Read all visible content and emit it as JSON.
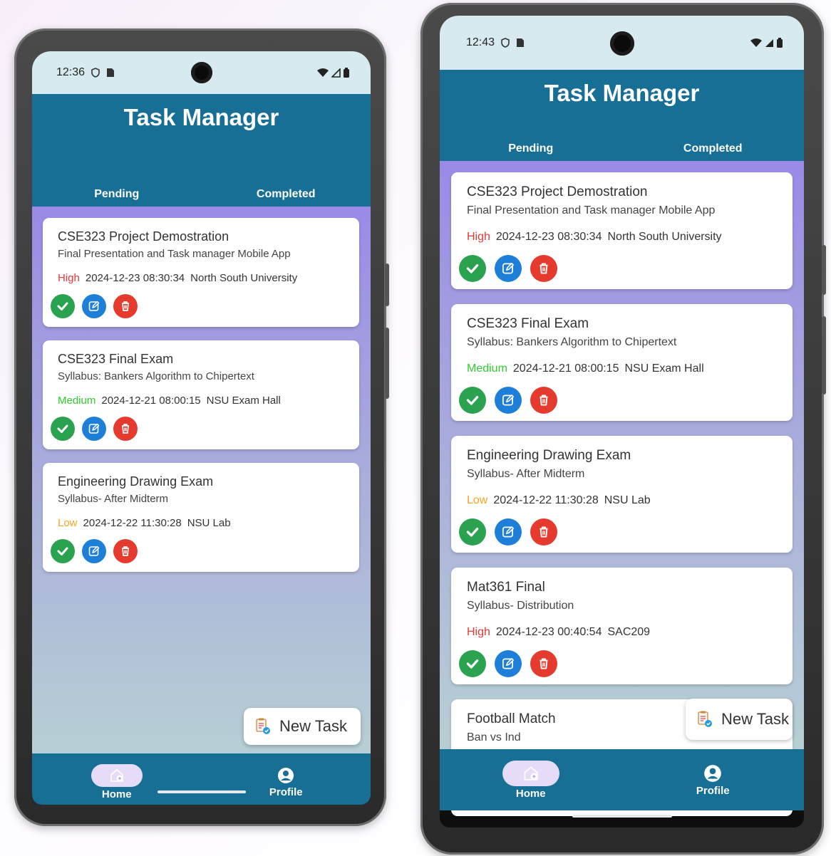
{
  "screens": [
    {
      "status_time": "12:36",
      "app_title": "Task Manager",
      "tabs": [
        "Pending",
        "Completed"
      ],
      "tasks": [
        {
          "title": "CSE323 Project Demostration",
          "description": "Final Presentation and Task manager Mobile App",
          "priority": "High",
          "priority_color": "#e53935",
          "datetime": "2024-12-23 08:30:34",
          "location": "North South University"
        },
        {
          "title": "CSE323 Final Exam",
          "description": "Syllabus: Bankers Algorithm to Chipertext",
          "priority": "Medium",
          "priority_color": "#2ecc2e",
          "datetime": "2024-12-21 08:00:15",
          "location": "NSU Exam Hall"
        },
        {
          "title": "Engineering Drawing Exam",
          "description": "Syllabus- After Midterm",
          "priority": "Low",
          "priority_color": "#f5a623",
          "datetime": "2024-12-22 11:30:28",
          "location": "NSU Lab"
        }
      ],
      "fab_label": "New Task",
      "nav": {
        "home": "Home",
        "profile": "Profile"
      }
    },
    {
      "status_time": "12:43",
      "app_title": "Task Manager",
      "tabs": [
        "Pending",
        "Completed"
      ],
      "tasks": [
        {
          "title": "CSE323 Project Demostration",
          "description": "Final Presentation and Task manager Mobile App",
          "priority": "High",
          "priority_color": "#e53935",
          "datetime": "2024-12-23 08:30:34",
          "location": "North South University"
        },
        {
          "title": "CSE323 Final Exam",
          "description": "Syllabus: Bankers Algorithm to Chipertext",
          "priority": "Medium",
          "priority_color": "#2ecc2e",
          "datetime": "2024-12-21 08:00:15",
          "location": "NSU Exam Hall"
        },
        {
          "title": "Engineering Drawing Exam",
          "description": "Syllabus- After Midterm",
          "priority": "Low",
          "priority_color": "#f5a623",
          "datetime": "2024-12-22 11:30:28",
          "location": "NSU Lab"
        },
        {
          "title": "Mat361 Final",
          "description": "Syllabus- Distribution",
          "priority": "High",
          "priority_color": "#e53935",
          "datetime": "2024-12-23 00:40:54",
          "location": "SAC209"
        },
        {
          "title": "Football Match",
          "description": "Ban vs Ind"
        }
      ],
      "fab_label": "New Task",
      "nav": {
        "home": "Home",
        "profile": "Profile"
      }
    }
  ],
  "icons": {
    "status": [
      "vpn-key-icon",
      "sim-card-icon",
      "wifi-icon",
      "signal-icon",
      "battery-icon"
    ],
    "actions": [
      "check-circle-icon",
      "edit-icon",
      "delete-icon"
    ],
    "fab": "task-add-icon",
    "nav": [
      "home-add-icon",
      "account-circle-icon"
    ]
  },
  "colors": {
    "app_bar": "#176f95",
    "status_bar": "#d6eaf0",
    "complete": "#2ba24f",
    "edit": "#1e7fd8",
    "delete": "#e53b2f",
    "nav_pill": "#e7dcf7"
  }
}
